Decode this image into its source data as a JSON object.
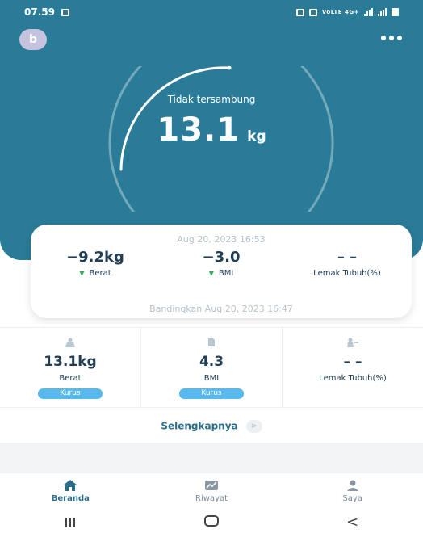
{
  "status_bar": {
    "time": "07.59",
    "network_text": "VoLTE 4G+"
  },
  "header": {
    "avatar_initial": "b",
    "more_icon": "more-dots-icon"
  },
  "scale": {
    "connection_status": "Tidak tersambung",
    "weight_value": "13.1",
    "weight_unit": "kg"
  },
  "comparison": {
    "date": "Aug 20, 2023 16:53",
    "metrics": [
      {
        "value": "−9.2kg",
        "label": "Berat",
        "trend": "down"
      },
      {
        "value": "−3.0",
        "label": "BMI",
        "trend": "down"
      },
      {
        "value": "– –",
        "label": "Lemak Tubuh(%)",
        "trend": "none"
      }
    ],
    "compare_text": "Bandingkan Aug 20, 2023 16:47"
  },
  "stats": [
    {
      "icon": "scale-person-icon",
      "value": "13.1kg",
      "label": "Berat",
      "badge": "Kurus"
    },
    {
      "icon": "bmi-icon",
      "value": "4.3",
      "label": "BMI",
      "badge": "Kurus"
    },
    {
      "icon": "body-fat-icon",
      "value": "– –",
      "label": "Lemak Tubuh(%)",
      "badge": ""
    }
  ],
  "more_link": {
    "label": "Selengkapnya",
    "chevron": ">"
  },
  "bottom_nav": [
    {
      "label": "Beranda",
      "icon": "home-icon",
      "active": true
    },
    {
      "label": "Riwayat",
      "icon": "chart-icon",
      "active": false
    },
    {
      "label": "Saya",
      "icon": "person-icon",
      "active": false
    }
  ],
  "system_nav": {
    "back_symbol": "<"
  },
  "colors": {
    "primary": "#2a7b98",
    "accent_badge": "#58b9ef",
    "trend_down": "#3aaa5e",
    "text_dark": "#213e54"
  }
}
